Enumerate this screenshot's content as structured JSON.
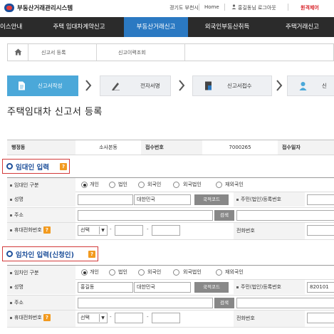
{
  "header": {
    "app_title": "부동산거래관리시스템",
    "region": "경기도 부천시",
    "home": "Home",
    "user_logout": "홍길동님 로그아웃",
    "remote_support": "원격제어"
  },
  "nav": {
    "items": [
      {
        "label": "이스안내"
      },
      {
        "label": "주택 임대차계약신고"
      },
      {
        "label": "부동산거래신고"
      },
      {
        "label": "외국인부동산취득"
      },
      {
        "label": "주택거래신고"
      }
    ],
    "active_index": 2
  },
  "breadcrumb": {
    "home_icon": "home-icon",
    "items": [
      "신고서 등록",
      "신고이력조회"
    ]
  },
  "steps": [
    {
      "label": "신고서작성",
      "icon": "document-icon"
    },
    {
      "label": "전자서명",
      "icon": "pen-icon"
    },
    {
      "label": "신고서접수",
      "icon": "stamp-icon"
    },
    {
      "label": "신",
      "icon": "person-icon"
    }
  ],
  "page_title": "주택임대차 신고서 등록",
  "info": {
    "office_label": "행정동",
    "office_value": "소사본동",
    "receipt_no_label": "접수번호",
    "receipt_no_value": "7000265",
    "receipt_date_label": "접수일자"
  },
  "lessor": {
    "section_title": "임대인 입력",
    "type_label": "임대인 구분",
    "type_options": [
      "개인",
      "법인",
      "외국인",
      "외국법인",
      "재외국인"
    ],
    "type_selected": "개인",
    "name_label": "성명",
    "name_value": "",
    "nationality_value": "대한민국",
    "country_code_button": "국적코드",
    "id_label": "주민(법인)등록번호",
    "id_value": "",
    "address_label": "주소",
    "search_button": "검색",
    "mobile_label": "휴대전화번호",
    "mobile_prefix": "선택",
    "phone_label": "전화번호"
  },
  "lessee": {
    "section_title": "임차인 입력(신청인)",
    "type_label": "임차인 구분",
    "type_options": [
      "개인",
      "법인",
      "외국인",
      "외국법인",
      "재외국인"
    ],
    "type_selected": "개인",
    "name_label": "성명",
    "name_value": "홍길동",
    "nationality_value": "대한민국",
    "country_code_button": "국적코드",
    "id_label": "주민(법인)등록번호",
    "id_value": "820101",
    "address_label": "주소",
    "search_button": "검색",
    "mobile_label": "휴대전화번호",
    "mobile_prefix": "선택",
    "phone_label": "전화번호"
  },
  "colors": {
    "nav_bg": "#2b2b2b",
    "nav_active": "#2b79c2",
    "step_active": "#4ba8d9",
    "section_title": "#1d4f9a",
    "section_box": "#d23a3a",
    "help_badge": "#f29a1f",
    "remote_link": "#d8232a"
  },
  "help_badge_text": "?"
}
